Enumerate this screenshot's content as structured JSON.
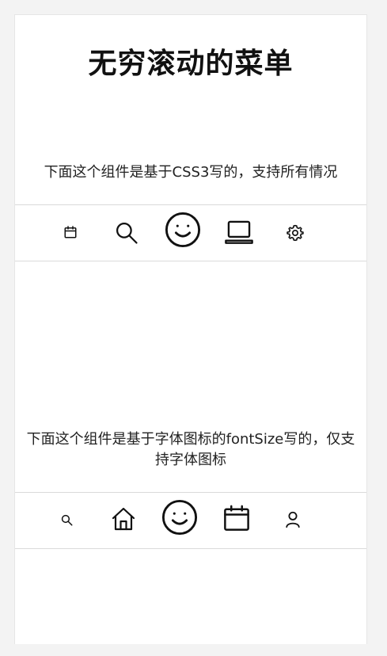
{
  "header": {
    "title": "无穷滚动的菜单"
  },
  "sections": [
    {
      "description": "下面这个组件是基于CSS3写的，支持所有情况",
      "icons": [
        "calendar-icon",
        "search-icon",
        "smiley-icon",
        "laptop-icon",
        "gear-icon"
      ]
    },
    {
      "description": "下面这个组件是基于字体图标的fontSize写的，仅支持字体图标",
      "icons": [
        "search-icon",
        "home-icon",
        "smiley-icon",
        "calendar-icon",
        "user-icon"
      ]
    }
  ],
  "colors": {
    "page_background": "#ffffff",
    "outer_background": "#f3f3f3",
    "icon_stroke": "#111111",
    "menu_border": "#dadada"
  }
}
